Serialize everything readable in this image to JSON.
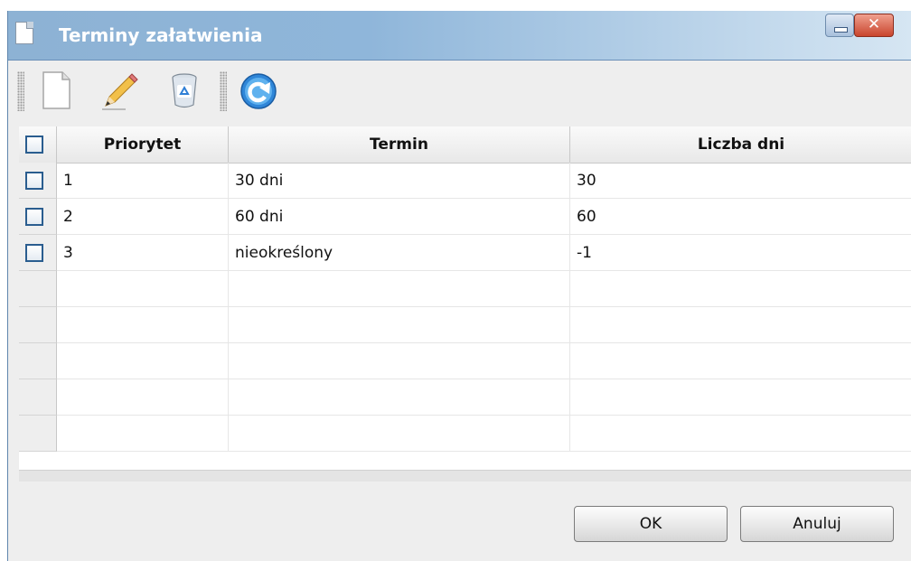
{
  "window": {
    "title": "Terminy załatwienia",
    "close_glyph": "✕"
  },
  "toolbar": {
    "buttons": [
      {
        "name": "new-document-icon"
      },
      {
        "name": "edit-pencil-icon"
      },
      {
        "name": "recycle-bin-icon"
      },
      {
        "name": "refresh-icon"
      }
    ]
  },
  "table": {
    "columns": [
      "Priorytet",
      "Termin",
      "Liczba dni"
    ],
    "rows": [
      {
        "priorytet": "1",
        "termin": "30 dni",
        "liczba_dni": "30"
      },
      {
        "priorytet": "2",
        "termin": "60 dni",
        "liczba_dni": "60"
      },
      {
        "priorytet": "3",
        "termin": "nieokreślony",
        "liczba_dni": "-1"
      }
    ],
    "empty_rows": 5
  },
  "buttons": {
    "ok": "OK",
    "cancel": "Anuluj"
  },
  "colors": {
    "titlebar": "#8fb6da",
    "checkbox_border": "#2a5d8f"
  }
}
